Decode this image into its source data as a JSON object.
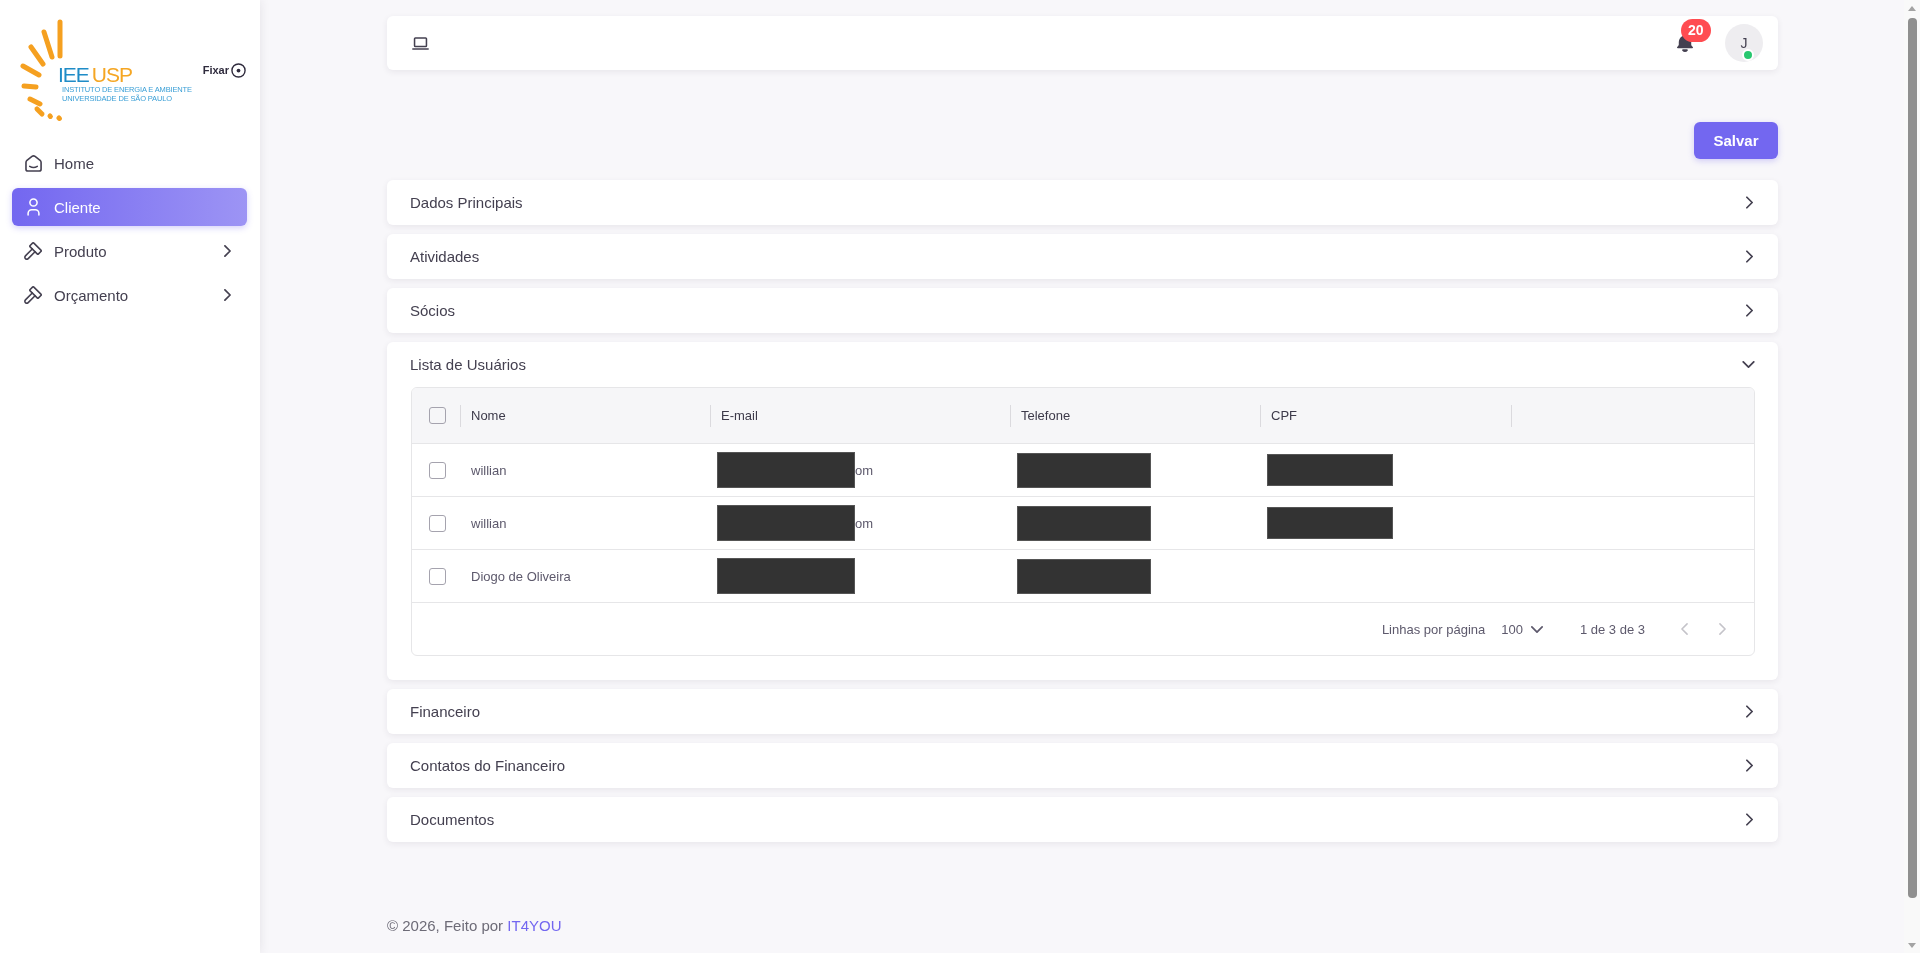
{
  "sidebar": {
    "logo": {
      "wordmark_part_1": "IEE",
      "wordmark_part_2": "USP",
      "line_1": "INSTITUTO DE ENERGIA E AMBIENTE",
      "line_2": "UNIVERSIDADE DE SÃO PAULO"
    },
    "pin": {
      "label": "Fixar",
      "checked": true
    },
    "items": [
      {
        "label": "Home",
        "kind": "home",
        "selected": false,
        "submenu": false
      },
      {
        "label": "Cliente",
        "kind": "user",
        "selected": true,
        "submenu": false
      },
      {
        "label": "Produto",
        "kind": "hammer",
        "selected": false,
        "submenu": true
      },
      {
        "label": "Orçamento",
        "kind": "hammer",
        "selected": false,
        "submenu": true
      }
    ]
  },
  "topbar": {
    "notifications": {
      "count": "20"
    },
    "avatar": {
      "initial": "J",
      "online": true
    }
  },
  "save_button": {
    "label": "Salvar"
  },
  "sections": [
    {
      "title": "Dados Principais",
      "expanded": false
    },
    {
      "title": "Atividades",
      "expanded": false
    },
    {
      "title": "Sócios",
      "expanded": false
    },
    {
      "title": "Lista de Usuários",
      "expanded": true,
      "table": {
        "select_all": {
          "checked": false
        },
        "columns": [
          {
            "label": "Nome"
          },
          {
            "label": "E-mail"
          },
          {
            "label": "Telefone"
          },
          {
            "label": "CPF"
          }
        ],
        "rows": [
          {
            "checked": false,
            "cells": [
              {
                "text": "willian"
              },
              {
                "text": "om",
                "redacted": true
              },
              {
                "redacted": true
              },
              {
                "redacted": true
              }
            ]
          },
          {
            "checked": false,
            "cells": [
              {
                "text": "willian"
              },
              {
                "text": "om",
                "redacted": true
              },
              {
                "redacted": true
              },
              {
                "redacted": true
              }
            ]
          },
          {
            "checked": false,
            "cells": [
              {
                "text": "Diogo de Oliveira"
              },
              {
                "redacted": true
              },
              {
                "redacted": true
              }
            ]
          }
        ],
        "pagination": {
          "rows_per_page_label": "Linhas por página",
          "rows_per_page": "100",
          "range": "1 de 3 de 3",
          "previous": {
            "disabled": true
          },
          "next": {
            "disabled": true
          }
        }
      }
    },
    {
      "title": "Financeiro",
      "expanded": false
    },
    {
      "title": "Contatos do Financeiro",
      "expanded": false
    },
    {
      "title": "Documentos",
      "expanded": false
    }
  ],
  "footer": {
    "text": "© 2026, Feito por",
    "link": "IT4YOU"
  }
}
